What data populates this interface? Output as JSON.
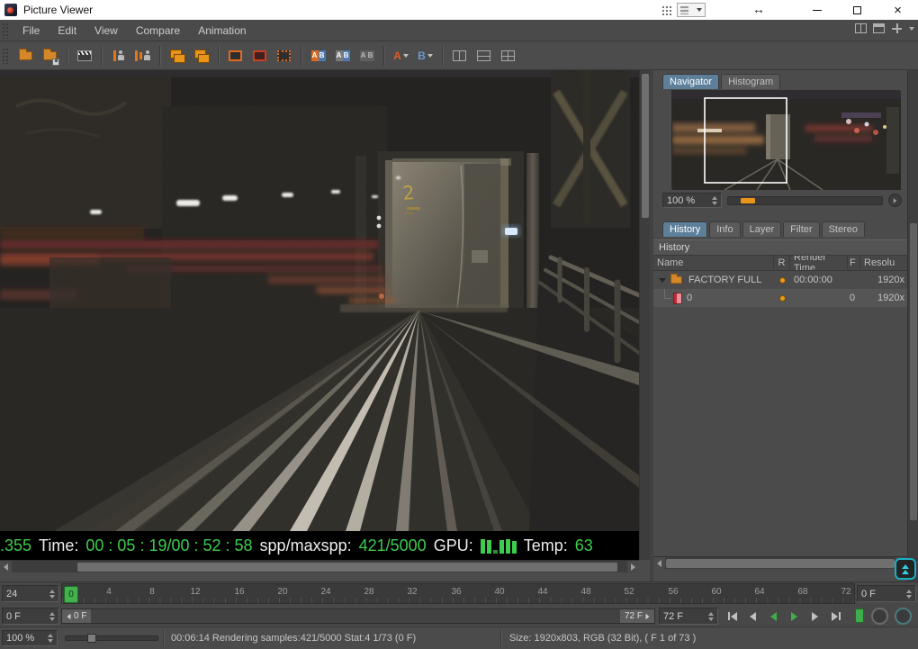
{
  "window": {
    "title": "Picture Viewer"
  },
  "menu": {
    "items": [
      "File",
      "Edit",
      "View",
      "Compare",
      "Animation"
    ]
  },
  "toolbar": {
    "icons": [
      "open",
      "save",
      "make-preview",
      "ram-player",
      "team-render",
      "layer-stack-a",
      "layer-stack-b",
      "region-render",
      "region-marquee",
      "region-clear",
      "compare-ab-color",
      "compare-ab-split",
      "compare-ab-off",
      "set-image-a",
      "set-image-b",
      "compare-vertical",
      "compare-horizontal",
      "compare-quad"
    ]
  },
  "viewport": {
    "stats": {
      "left_value": ".355",
      "time_label": "Time:",
      "time_value": "00 : 05 : 19/00 : 52 : 58",
      "spp_label": "spp/maxspp:",
      "spp_value": "421/5000",
      "gpu_label": "GPU:",
      "gpu_bars": [
        16,
        15,
        4,
        15,
        16,
        14
      ],
      "temp_label": "Temp:",
      "temp_value": "63"
    }
  },
  "navigator": {
    "tabs": [
      "Navigator",
      "Histogram"
    ],
    "active_tab": "Navigator",
    "zoom_value": "100 %"
  },
  "history_panel": {
    "tabs": [
      "History",
      "Info",
      "Layer",
      "Filter",
      "Stereo"
    ],
    "active_tab": "History",
    "section_title": "History",
    "columns": [
      "Name",
      "R",
      "Render Time",
      "F",
      "Resolu"
    ],
    "rows": [
      {
        "name": "FACTORY FULL",
        "render_time": "00:00:00",
        "f": "",
        "resolution": "1920x"
      },
      {
        "name": "0",
        "render_time": "",
        "f": "0",
        "resolution": "1920x"
      }
    ]
  },
  "timeline": {
    "fps_value": "24",
    "frame_value": "0 F",
    "end_value": "0 F",
    "playhead_label": "0",
    "ticks": [
      "4",
      "8",
      "12",
      "16",
      "20",
      "24",
      "28",
      "32",
      "36",
      "40",
      "44",
      "48",
      "52",
      "56",
      "60",
      "64",
      "68",
      "72"
    ],
    "range_start_label": "0 F",
    "range_end_label": "72 F",
    "range_dropdown_value": "72 F"
  },
  "statusbar": {
    "zoom_value": "100 %",
    "render_status": "00:06:14 Rendering samples:421/5000 Stat:4 1/73 (0 F)",
    "size_info": "Size: 1920x803, RGB (32 Bit), ( F 1 of 73 )"
  },
  "colors": {
    "accent_orange": "#e8941a",
    "value_green": "#3dcc4e",
    "play_green": "#3fae4a",
    "tab_active": "#5e7f9a"
  }
}
